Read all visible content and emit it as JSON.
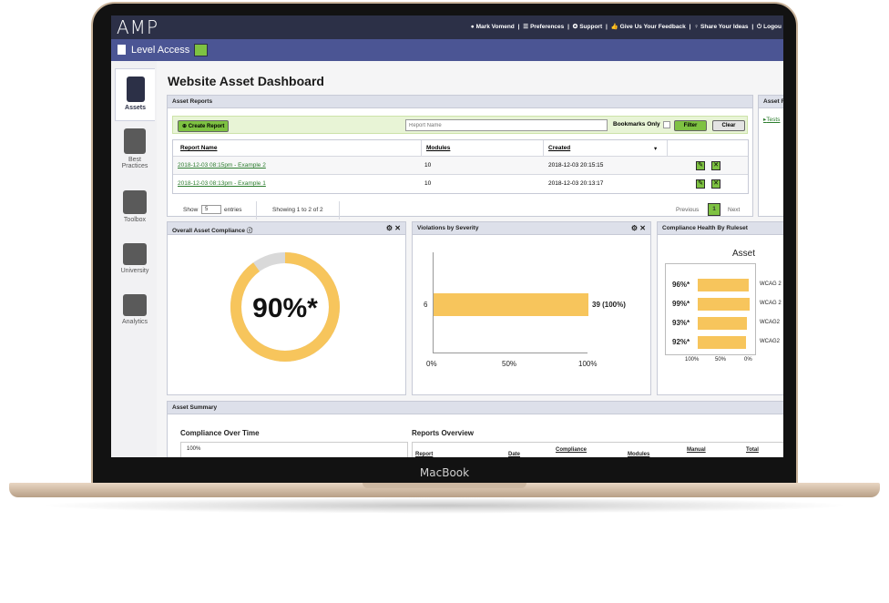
{
  "device": {
    "brand": "MacBook"
  },
  "topbar": {
    "logo": "AMP",
    "links": [
      "Mark Vomend",
      "|",
      "Preferences",
      "|",
      "Support",
      "|",
      "Give Us Your Feedback",
      "|",
      "Share Your Ideas",
      "|",
      "Logou"
    ]
  },
  "subbar": {
    "org_name": "Level Access"
  },
  "sidebar": {
    "items": [
      {
        "label": "Assets",
        "icon": "clipboard-list-icon",
        "active": true
      },
      {
        "label": "Best Practices",
        "icon": "book-icon"
      },
      {
        "label": "Toolbox",
        "icon": "toolbox-icon"
      },
      {
        "label": "University",
        "icon": "teacher-board-icon"
      },
      {
        "label": "Analytics",
        "icon": "line-chart-icon"
      }
    ]
  },
  "page": {
    "title": "Website Asset Dashboard"
  },
  "asset_reports": {
    "header": "Asset Reports",
    "create_button": "Create Report",
    "search_placeholder": "Report Name",
    "bookmarks_label": "Bookmarks Only",
    "filter_button": "Filter",
    "clear_button": "Clear",
    "columns": [
      "Report Name",
      "Modules",
      "Created"
    ],
    "rows": [
      {
        "name": "2018-12-03 08:15pm - Example 2",
        "modules": "10",
        "created": "2018-12-03 20:15:15"
      },
      {
        "name": "2018-12-03 08:13pm - Example 1",
        "modules": "10",
        "created": "2018-12-03 20:13:17"
      }
    ],
    "show_label": "Show",
    "show_value": "5",
    "entries_label": "entries",
    "showing_text": "Showing 1 to 2 of 2",
    "prev_label": "Previous",
    "page_number": "1",
    "next_label": "Next"
  },
  "side_panel": {
    "header": "Asset R",
    "link": "Tests"
  },
  "compliance": {
    "header": "Overall Asset Compliance",
    "value_label": "90%*",
    "percent": 90,
    "colors": {
      "fill": "#f7c55c",
      "rest": "#d9d9d9"
    }
  },
  "violations": {
    "header": "Violations by Severity",
    "category": "6",
    "value_label": "39 (100%)",
    "fraction": 1.0,
    "ticks": [
      "0%",
      "50%",
      "100%"
    ]
  },
  "health": {
    "header": "Compliance Health By Ruleset",
    "title": "Asset",
    "rows": [
      {
        "pct_label": "96%*",
        "label": "WCAG 2",
        "value": 96
      },
      {
        "pct_label": "99%*",
        "label": "WCAG 2",
        "value": 99
      },
      {
        "pct_label": "93%*",
        "label": "WCAG2",
        "value": 93
      },
      {
        "pct_label": "92%*",
        "label": "WCAG2",
        "value": 92
      }
    ],
    "ticks": [
      "100%",
      "50%",
      "0%"
    ]
  },
  "summary": {
    "header": "Asset Summary",
    "over_time_title": "Compliance Over Time",
    "over_time_tick": "100%",
    "overview_title": "Reports Overview",
    "overview_columns": [
      "Report",
      "Date",
      "Compliance",
      "Modules",
      "Manual",
      "Total"
    ]
  },
  "colors": {
    "topbar": "#2c3047",
    "subbar": "#4b5594",
    "accent_green": "#7ec242",
    "bar_yellow": "#f7c55c",
    "link_green": "#2c7d2e"
  }
}
